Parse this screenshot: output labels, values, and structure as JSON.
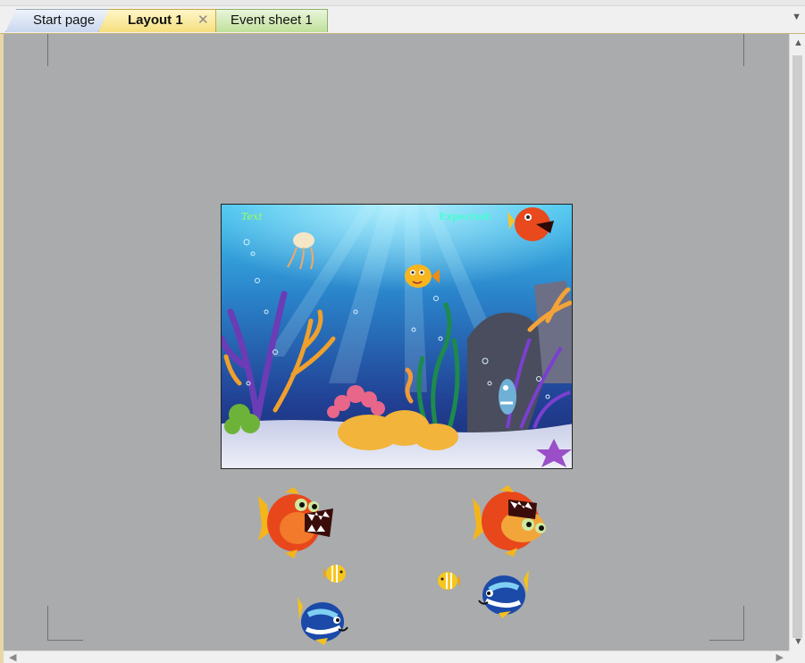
{
  "tabs": [
    {
      "label": "Start page"
    },
    {
      "label": "Layout 1",
      "active": true,
      "close_glyph": "✕"
    },
    {
      "label": "Event sheet 1"
    }
  ],
  "scene": {
    "texts": {
      "text_object": "Text",
      "expected_label": "Expected:"
    }
  },
  "colors": {
    "canvas_bg": "#a9abad",
    "tab_active": "#f5df7e",
    "tab_start": "#c9d7ee",
    "tab_event": "#bfe09a",
    "water_top": "#2aa8dc",
    "water_bottom": "#1c3b8a",
    "sand": "#dfe4f2"
  },
  "sprites": [
    {
      "name": "piranha-sprite",
      "icon": "red-piranha"
    },
    {
      "name": "piranha-sprite",
      "icon": "red-piranha"
    },
    {
      "name": "small-yellow-fish-sprite",
      "icon": "yellow-fish"
    },
    {
      "name": "small-yellow-fish-sprite",
      "icon": "yellow-fish"
    },
    {
      "name": "blue-tang-fish-sprite",
      "icon": "blue-fish"
    },
    {
      "name": "blue-tang-fish-sprite",
      "icon": "blue-fish"
    }
  ]
}
